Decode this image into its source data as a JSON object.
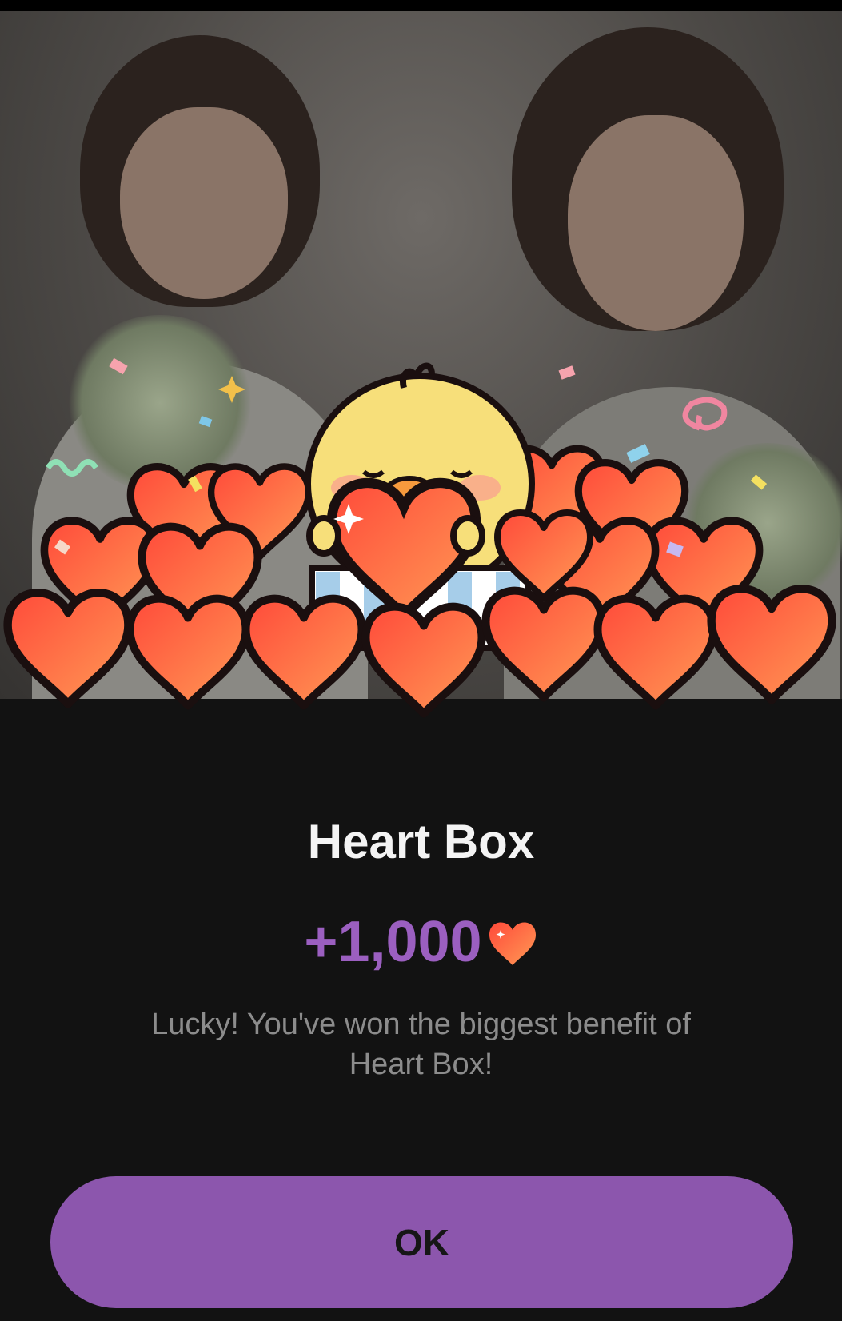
{
  "dialog": {
    "title": "Heart Box",
    "reward_amount": "+1,000",
    "reward_icon": "heart-icon",
    "message": "Lucky! You've won the biggest benefit of Heart Box!",
    "ok_label": "OK"
  },
  "colors": {
    "accent": "#8c56ad",
    "amount_text": "#9b5fc0",
    "background": "#121212",
    "heart": "#ff5a3c"
  }
}
